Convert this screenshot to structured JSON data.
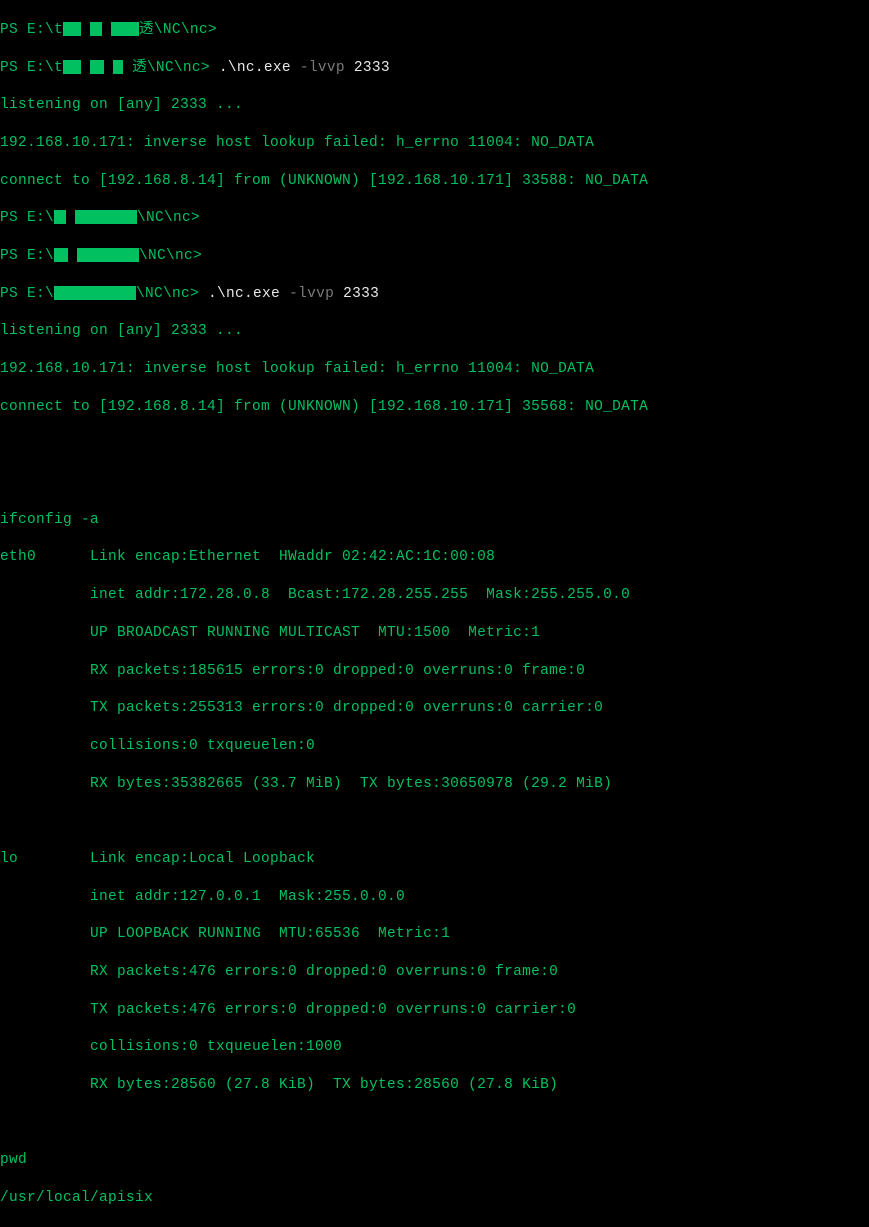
{
  "prompt1": {
    "prefix": "PS E:\\t",
    "suffix": "透\\NC\\nc>"
  },
  "prompt2": {
    "prefix": "PS E:\\t",
    "suffix": "透\\NC\\nc> ",
    "cmd_dot": ".",
    "cmd_nc": "\\nc.exe ",
    "cmd_flag": "-lvvp ",
    "cmd_port": "2333"
  },
  "listen1": "listening on [any] 2333 ...",
  "lookup1": "192.168.10.171: inverse host lookup failed: h_errno 11004: NO_DATA",
  "connect1": "connect to [192.168.8.14] from (UNKNOWN) [192.168.10.171] 33588: NO_DATA",
  "prompt3": {
    "prefix": "PS E:\\",
    "suffix": "\\NC\\nc>"
  },
  "prompt4": {
    "prefix": "PS E:\\",
    "suffix": "\\NC\\nc>"
  },
  "prompt5": {
    "prefix": "PS E:\\",
    "suffix": "\\NC\\nc> ",
    "cmd_dot": ".",
    "cmd_nc": "\\nc.exe ",
    "cmd_flag": "-lvvp ",
    "cmd_port": "2333"
  },
  "listen2": "listening on [any] 2333 ...",
  "lookup2": "192.168.10.171: inverse host lookup failed: h_errno 11004: NO_DATA",
  "connect2": "connect to [192.168.8.14] from (UNKNOWN) [192.168.10.171] 35568: NO_DATA",
  "ifconfig_cmd": "ifconfig -a",
  "eth0": {
    "l1": "eth0      Link encap:Ethernet  HWaddr 02:42:AC:1C:00:08",
    "l2": "          inet addr:172.28.0.8  Bcast:172.28.255.255  Mask:255.255.0.0",
    "l3": "          UP BROADCAST RUNNING MULTICAST  MTU:1500  Metric:1",
    "l4": "          RX packets:185615 errors:0 dropped:0 overruns:0 frame:0",
    "l5": "          TX packets:255313 errors:0 dropped:0 overruns:0 carrier:0",
    "l6": "          collisions:0 txqueuelen:0",
    "l7": "          RX bytes:35382665 (33.7 MiB)  TX bytes:30650978 (29.2 MiB)"
  },
  "lo": {
    "l1": "lo        Link encap:Local Loopback",
    "l2": "          inet addr:127.0.0.1  Mask:255.0.0.0",
    "l3": "          UP LOOPBACK RUNNING  MTU:65536  Metric:1",
    "l4": "          RX packets:476 errors:0 dropped:0 overruns:0 frame:0",
    "l5": "          TX packets:476 errors:0 dropped:0 overruns:0 carrier:0",
    "l6": "          collisions:0 txqueuelen:1000",
    "l7": "          RX bytes:28560 (27.8 KiB)  TX bytes:28560 (27.8 KiB)"
  },
  "pwd_cmd": "pwd",
  "pwd_out": "/usr/local/apisix"
}
